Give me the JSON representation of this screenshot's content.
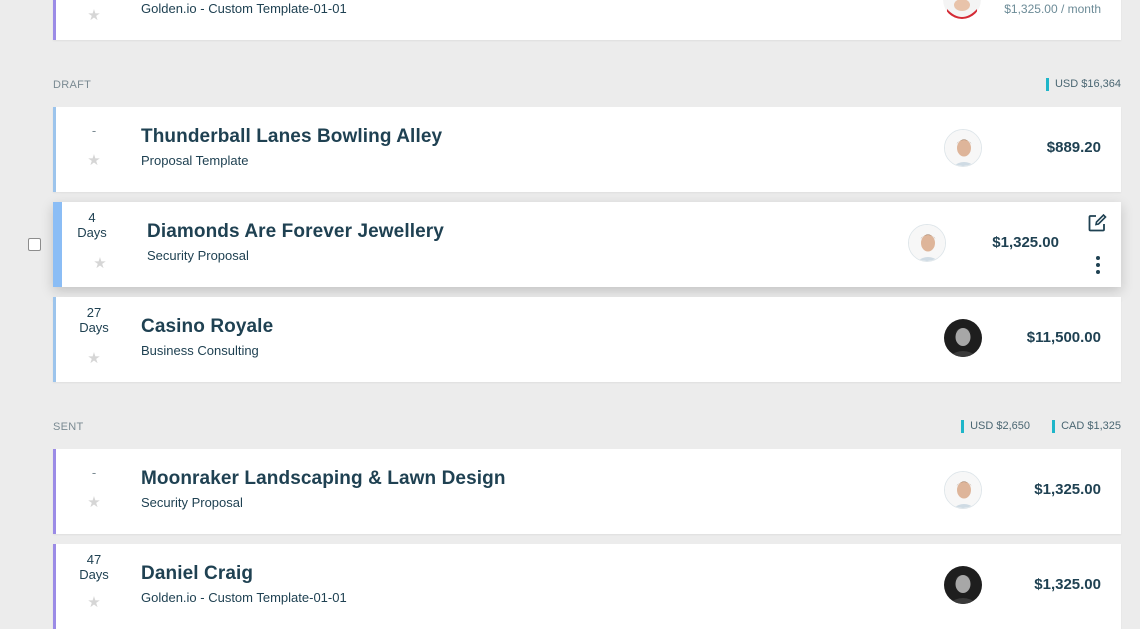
{
  "top_card": {
    "subtitle": "Golden.io - Custom Template-01-01",
    "amount": "$1,325.00 / month"
  },
  "sections": {
    "draft": {
      "label": "DRAFT",
      "totals": [
        "USD $16,364"
      ]
    },
    "sent": {
      "label": "SENT",
      "totals": [
        "USD $2,650",
        "CAD $1,325"
      ]
    }
  },
  "cards": [
    {
      "days_num": "-",
      "days_unit": "",
      "title": "Thunderball Lanes Bowling Alley",
      "subtitle": "Proposal Template",
      "amount": "$889.20",
      "avatar": "man-light-shirt"
    },
    {
      "days_num": "4",
      "days_unit": "Days",
      "title": "Diamonds Are Forever Jewellery",
      "subtitle": "Security Proposal",
      "amount": "$1,325.00",
      "avatar": "man-light-shirt"
    },
    {
      "days_num": "27",
      "days_unit": "Days",
      "title": "Casino Royale",
      "subtitle": "Business Consulting",
      "amount": "$11,500.00",
      "avatar": "man-dark-photo"
    },
    {
      "days_num": "-",
      "days_unit": "",
      "title": "Moonraker Landscaping & Lawn Design",
      "subtitle": "Security Proposal",
      "amount": "$1,325.00",
      "avatar": "man-light-shirt"
    },
    {
      "days_num": "47",
      "days_unit": "Days",
      "title": "Daniel Craig",
      "subtitle": "Golden.io - Custom Template-01-01",
      "amount": "$1,325.00",
      "avatar": "man-dark-photo"
    }
  ],
  "icons": {
    "star": "star-icon",
    "edit": "edit-icon",
    "more": "more-vertical-icon"
  }
}
